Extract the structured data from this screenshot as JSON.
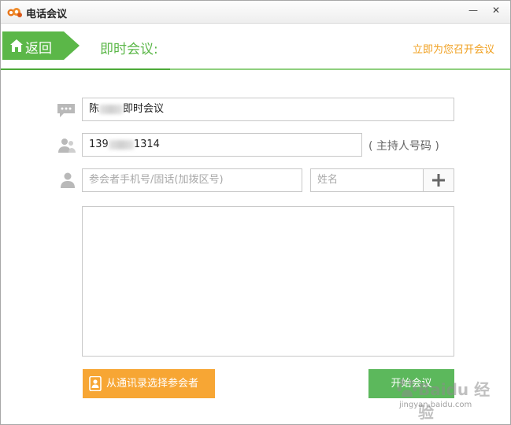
{
  "window": {
    "title": "电话会议",
    "minimize_label": "—",
    "close_label": "✕"
  },
  "header": {
    "back_label": "返回",
    "page_title": "即时会议:",
    "quick_link": "立即为您召开会议"
  },
  "form": {
    "meeting_name_prefix": "陈",
    "meeting_name_suffix": "即时会议",
    "host_phone_prefix": "139",
    "host_phone_suffix": "1314",
    "host_label": "( 主持人号码 )",
    "participant_phone_placeholder": "参会者手机号/固话(加拨区号)",
    "participant_name_placeholder": "姓名",
    "add_label": "+"
  },
  "actions": {
    "contacts_button": "从通讯录选择参会者",
    "start_button": "开始会议"
  },
  "watermark": {
    "main": "Baidu 经验",
    "sub": "jingyan.baidu.com"
  },
  "colors": {
    "accent_green": "#5bb748",
    "button_green": "#5cb85c",
    "accent_orange": "#f7a634",
    "link_orange": "#f0a020"
  }
}
